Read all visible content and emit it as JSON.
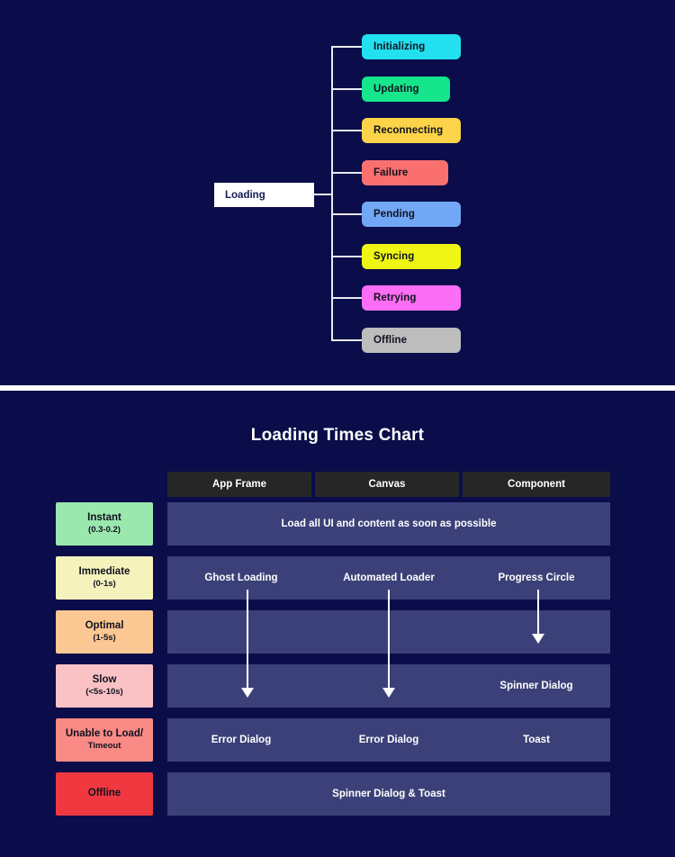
{
  "tree": {
    "root": {
      "label": "Loading",
      "bg": "#ffffff",
      "fg": "#141a52"
    },
    "children": [
      {
        "label": "Initializing",
        "bg": "#22e0f0"
      },
      {
        "label": "Updating",
        "bg": "#15e68c"
      },
      {
        "label": "Reconnecting",
        "bg": "#fcd349"
      },
      {
        "label": "Failure",
        "bg": "#f9706e"
      },
      {
        "label": "Pending",
        "bg": "#71a7f5"
      },
      {
        "label": "Syncing",
        "bg": "#f0f613"
      },
      {
        "label": "Retrying",
        "bg": "#fb6ef5"
      },
      {
        "label": "Offline",
        "bg": "#bdbdbd"
      }
    ]
  },
  "chart": {
    "title": "Loading Times Chart",
    "columns": [
      {
        "label": "App Frame"
      },
      {
        "label": "Canvas"
      },
      {
        "label": "Component"
      }
    ],
    "rows": [
      {
        "label": "Instant",
        "sub": "(0.3-0.2)",
        "color": "#9be8ae",
        "span": true,
        "cells": [
          "Load all UI and content as soon as possible"
        ]
      },
      {
        "label": "Immediate",
        "sub": "(0-1s)",
        "color": "#f5f2bc",
        "span": false,
        "cells": [
          "Ghost Loading",
          "Automated Loader",
          "Progress Circle"
        ]
      },
      {
        "label": "Optimal",
        "sub": "(1-5s)",
        "color": "#fbc792",
        "span": false,
        "cells": [
          "",
          "",
          ""
        ]
      },
      {
        "label": "Slow",
        "sub": "(<5s-10s)",
        "color": "#fbc2c6",
        "span": false,
        "cells": [
          "",
          "",
          "Spinner Dialog"
        ]
      },
      {
        "label": "Unable to Load/",
        "sub": "Timeout",
        "color": "#f98a85",
        "span": false,
        "cells": [
          "Error Dialog",
          "Error Dialog",
          "Toast"
        ]
      },
      {
        "label": "Offline",
        "sub": "",
        "color": "#ef3840",
        "span": true,
        "cells": [
          "Spinner Dialog & Toast"
        ]
      }
    ]
  },
  "colors": {
    "background": "#0a0d4a",
    "header_cell": "#262626",
    "body_cell": "#3b4178",
    "divider": "#ffffff",
    "connector": "#e9eaf2",
    "arrow": "#ffffff"
  },
  "chart_data": {
    "type": "table",
    "title": "Loading Times Chart",
    "columns": [
      "",
      "App Frame",
      "Canvas",
      "Component"
    ],
    "rows": [
      [
        "Instant (0.3-0.2)",
        "Load all UI and content as soon as possible",
        "Load all UI and content as soon as possible",
        "Load all UI and content as soon as possible"
      ],
      [
        "Immediate (0-1s)",
        "Ghost Loading",
        "Automated Loader",
        "Progress Circle"
      ],
      [
        "Optimal (1-5s)",
        "",
        "",
        ""
      ],
      [
        "Slow (<5s-10s)",
        "",
        "",
        "Spinner Dialog"
      ],
      [
        "Unable to Load/Timeout",
        "Error Dialog",
        "Error Dialog",
        "Toast"
      ],
      [
        "Offline",
        "Spinner Dialog & Toast",
        "Spinner Dialog & Toast",
        "Spinner Dialog & Toast"
      ]
    ],
    "annotations": [
      {
        "type": "arrow",
        "column": "App Frame",
        "from_row": "Immediate (0-1s)",
        "to_row": "Slow (<5s-10s)"
      },
      {
        "type": "arrow",
        "column": "Canvas",
        "from_row": "Immediate (0-1s)",
        "to_row": "Slow (<5s-10s)"
      },
      {
        "type": "arrow",
        "column": "Component",
        "from_row": "Immediate (0-1s)",
        "to_row": "Optimal (1-5s)"
      }
    ]
  }
}
